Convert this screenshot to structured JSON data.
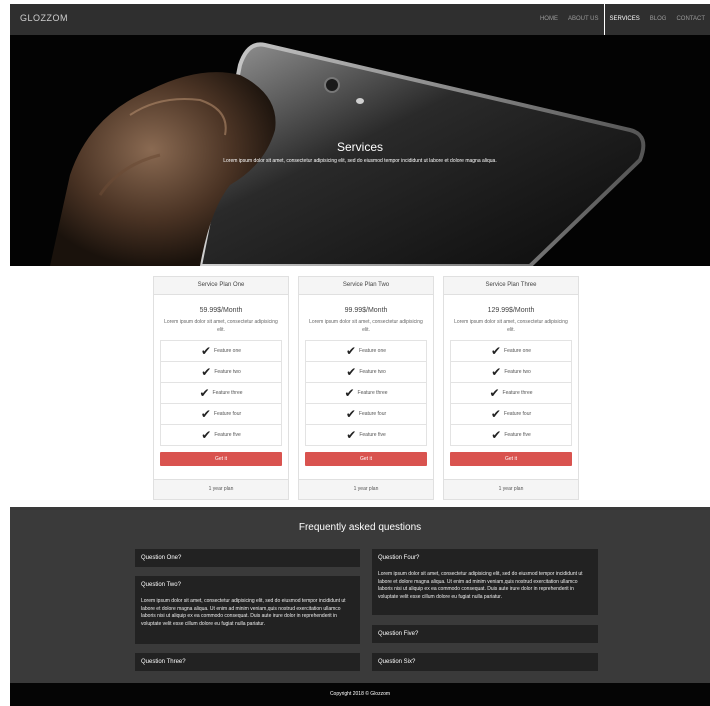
{
  "nav": {
    "brand": "GLOZZOM",
    "items": [
      "HOME",
      "ABOUT US",
      "SERVICES",
      "BLOG",
      "CONTACT"
    ],
    "active": "SERVICES"
  },
  "hero": {
    "title": "Services",
    "subtitle": "Lorem ipsum dolor sit amet, consectetur adipisicing elit, sed do eiusmod tempor incididunt ut labore et dolore magna aliqua."
  },
  "plans": [
    {
      "name": "Service Plan One",
      "price": "59.99$/Month",
      "description": "Lorem ipsum dolor sit amet, consectetur adipisicing elit.",
      "features": [
        "Feature one",
        "Feature two",
        "Feature three",
        "Feature four",
        "Feature five"
      ],
      "button": "Get it",
      "footer": "1 year plan"
    },
    {
      "name": "Service Plan Two",
      "price": "99.99$/Month",
      "description": "Lorem ipsum dolor sit amet, consectetur adipisicing elit.",
      "features": [
        "Feature one",
        "Feature two",
        "Feature three",
        "Feature four",
        "Feature five"
      ],
      "button": "Get it",
      "footer": "1 year plan"
    },
    {
      "name": "Service Plan Three",
      "price": "129.99$/Month",
      "description": "Lorem ipsum dolor sit amet, consectetur adipisicing elit.",
      "features": [
        "Feature one",
        "Feature two",
        "Feature three",
        "Feature four",
        "Feature five"
      ],
      "button": "Get it",
      "footer": "1 year plan"
    }
  ],
  "faq": {
    "title": "Frequently asked questions",
    "questions": [
      {
        "title": "Question One?",
        "answer": ""
      },
      {
        "title": "Question Two?",
        "answer": "Lorem ipsum dolor sit amet, consectetur adipisicing elit, sed do eiusmod tempor incididunt ut labore et dolore magna aliqua. Ut enim ad minim veniam,quis nostrud exercitation ullamco laboris nisi ut aliquip ex ea commodo consequat. Duis aute irure dolor in reprehenderit in voluptate velit esse cillum dolore eu fugiat nulla pariatur."
      },
      {
        "title": "Question Three?",
        "answer": ""
      },
      {
        "title": "Question Four?",
        "answer": "Lorem ipsum dolor sit amet, consectetur adipisicing elit, sed do eiusmod tempor incididunt ut labore et dolore magna aliqua. Ut enim ad minim veniam,quis nostrud exercitation ullamco laboris nisi ut aliquip ex ea commodo consequat. Duis aute irure dolor in reprehenderit in voluptate velit esse cillum dolore eu fugiat nulla pariatur."
      },
      {
        "title": "Question Five?",
        "answer": ""
      },
      {
        "title": "Question Six?",
        "answer": ""
      }
    ]
  },
  "footer": {
    "copyright": "Copyright 2018 © Glozzom"
  },
  "colors": {
    "nav_bg": "#2f2f2f",
    "faq_bg": "#3a3a3a",
    "question_bg": "#222222",
    "button": "#d9534f",
    "footer_bg": "#050505"
  },
  "icons": {
    "feature": "check-icon"
  }
}
